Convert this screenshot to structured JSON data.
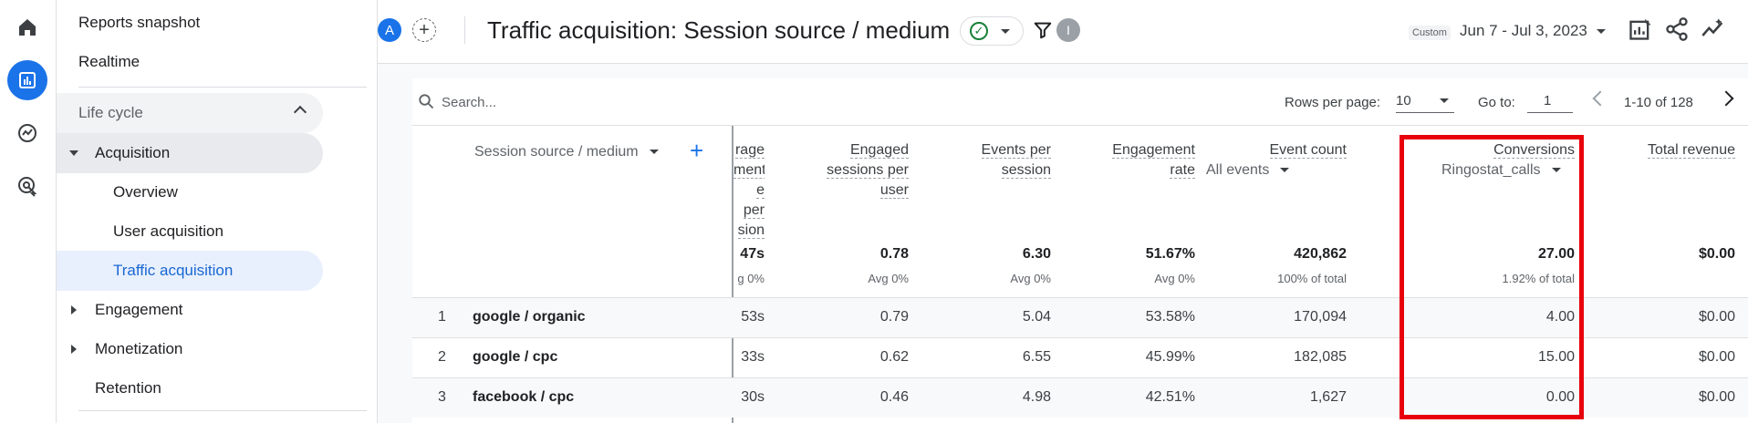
{
  "nav": {
    "reports_snapshot": "Reports snapshot",
    "realtime": "Realtime",
    "life_cycle": "Life cycle",
    "acquisition": "Acquisition",
    "overview": "Overview",
    "user_acquisition": "User acquisition",
    "traffic_acquisition": "Traffic acquisition",
    "engagement": "Engagement",
    "monetization": "Monetization",
    "retention": "Retention"
  },
  "header": {
    "avatar_letter": "A",
    "title": "Traffic acquisition: Session source / medium",
    "info_letter": "I",
    "custom_tag": "Custom",
    "date_range": "Jun 7 - Jul 3, 2023"
  },
  "toolbar": {
    "search_placeholder": "Search...",
    "rows_per_page_label": "Rows per page:",
    "rows_per_page_value": "10",
    "goto_label": "Go to:",
    "goto_value": "1",
    "pagination_text": "1-10 of 128"
  },
  "table": {
    "dimension_header": "Session source / medium",
    "columns": {
      "avg_partial": [
        "rage",
        "ment",
        "e per",
        "sion"
      ],
      "engaged_sessions": [
        "Engaged",
        "sessions per",
        "user"
      ],
      "events_per_session": [
        "Events per",
        "session"
      ],
      "engagement_rate": [
        "Engagement",
        "rate"
      ],
      "event_count": "Event count",
      "event_count_sub": "All events",
      "conversions": "Conversions",
      "conversions_sub": "Ringostat_calls",
      "total_revenue": "Total revenue"
    },
    "totals": {
      "avg_partial": "47s",
      "avg_partial_sub": "g 0%",
      "engaged_sessions": "0.78",
      "engaged_sessions_sub": "Avg 0%",
      "events_per_session": "6.30",
      "events_per_session_sub": "Avg 0%",
      "engagement_rate": "51.67%",
      "engagement_rate_sub": "Avg 0%",
      "event_count": "420,862",
      "event_count_sub": "100% of total",
      "conversions": "27.00",
      "conversions_sub": "1.92% of total",
      "total_revenue": "$0.00"
    },
    "rows": [
      {
        "num": "1",
        "dim": "google / organic",
        "avg": "53s",
        "eng": "0.79",
        "eps": "5.04",
        "rate": "53.58%",
        "events": "170,094",
        "conv": "4.00",
        "rev": "$0.00"
      },
      {
        "num": "2",
        "dim": "google / cpc",
        "avg": "33s",
        "eng": "0.62",
        "eps": "6.55",
        "rate": "45.99%",
        "events": "182,085",
        "conv": "15.00",
        "rev": "$0.00"
      },
      {
        "num": "3",
        "dim": "facebook / cpc",
        "avg": "30s",
        "eng": "0.46",
        "eps": "4.98",
        "rate": "42.51%",
        "events": "1,627",
        "conv": "0.00",
        "rev": "$0.00"
      }
    ]
  },
  "colors": {
    "accent": "#1a73e8",
    "highlight_box": "#e8000b",
    "selected_nav_bg": "#e8f0fe"
  }
}
